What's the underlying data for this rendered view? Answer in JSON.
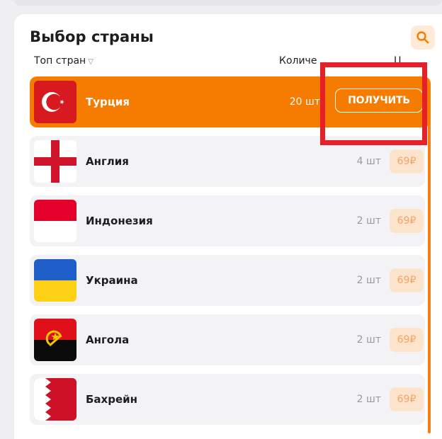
{
  "header": {
    "title": "Выбор страны",
    "col_top": "Топ стран",
    "col_qty": "Количе",
    "col_price": "Ц"
  },
  "active_row": {
    "name": "Турция",
    "qty": "20 шт",
    "button_label": "ПОЛУЧИТЬ"
  },
  "rows": [
    {
      "name": "Англия",
      "qty": "4 шт",
      "price": "69₽"
    },
    {
      "name": "Индонезия",
      "qty": "2 шт",
      "price": "69₽"
    },
    {
      "name": "Украина",
      "qty": "2 шт",
      "price": "69₽"
    },
    {
      "name": "Ангола",
      "qty": "2 шт",
      "price": "69₽"
    },
    {
      "name": "Бахрейн",
      "qty": "2 шт",
      "price": "69₽"
    }
  ],
  "colors": {
    "accent": "#f57c00",
    "highlight": "#e5202a",
    "price_bg": "#fce3cc"
  },
  "icons": [
    "search-icon",
    "sort-triangle-icon"
  ]
}
